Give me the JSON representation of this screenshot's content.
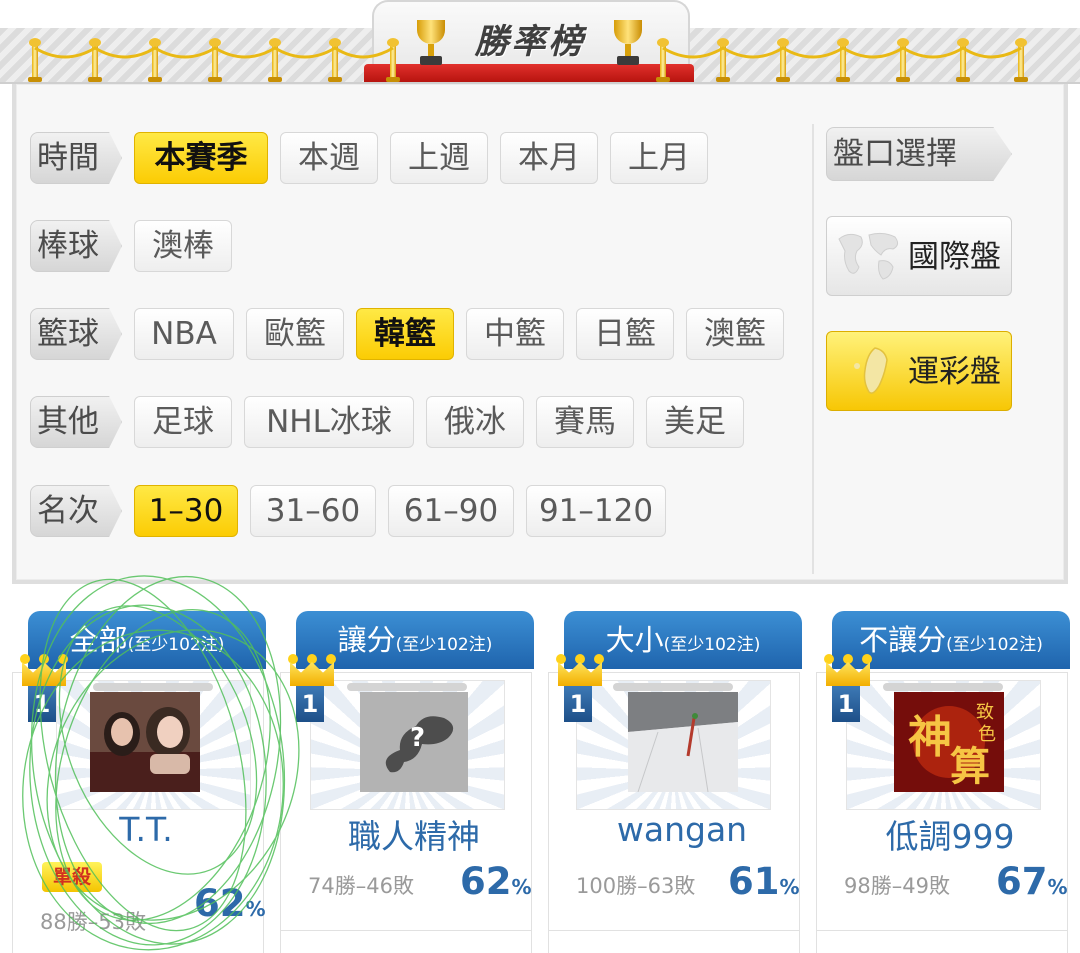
{
  "header": {
    "title": "勝率榜"
  },
  "filters": {
    "time": {
      "label": "時間",
      "options": [
        "本賽季",
        "本週",
        "上週",
        "本月",
        "上月"
      ],
      "selected": "本賽季"
    },
    "baseball": {
      "label": "棒球",
      "options": [
        "澳棒"
      ]
    },
    "basketball": {
      "label": "籃球",
      "options": [
        "NBA",
        "歐籃",
        "韓籃",
        "中籃",
        "日籃",
        "澳籃"
      ],
      "selected": "韓籃"
    },
    "other": {
      "label": "其他",
      "options": [
        "足球",
        "NHL冰球",
        "俄冰",
        "賽馬",
        "美足"
      ]
    },
    "rank": {
      "label": "名次",
      "options": [
        "1–30",
        "31–60",
        "61–90",
        "91–120"
      ],
      "selected": "1–30"
    }
  },
  "market": {
    "label": "盤口選擇",
    "international": "國際盤",
    "sport_lottery": "運彩盤",
    "selected": "運彩盤"
  },
  "cards": [
    {
      "category": "全部",
      "note": "(至少102注)",
      "rank": "1",
      "name": "T.T.",
      "tag": "單殺",
      "record": "88勝–53敗",
      "pct": "62",
      "pct_unit": "%"
    },
    {
      "category": "讓分",
      "note": "(至少102注)",
      "rank": "1",
      "name": "職人精神",
      "record": "74勝–46敗",
      "pct": "62",
      "pct_unit": "%"
    },
    {
      "category": "大小",
      "note": "(至少102注)",
      "rank": "1",
      "name": "wangan",
      "record": "100勝–63敗",
      "pct": "61",
      "pct_unit": "%"
    },
    {
      "category": "不讓分",
      "note": "(至少102注)",
      "rank": "1",
      "name": "低調999",
      "record": "98勝–49敗",
      "pct": "67",
      "pct_unit": "%"
    }
  ],
  "colors": {
    "accent_yellow": "#fbcc04",
    "header_blue": "#1f64ad",
    "text_blue": "#2d6aa9",
    "carpet_red": "#c91c17"
  }
}
